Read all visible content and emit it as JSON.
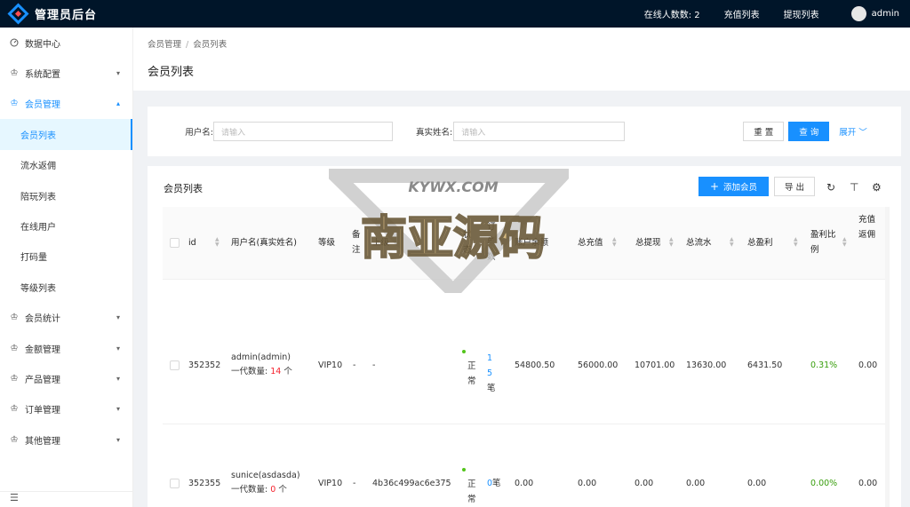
{
  "app": {
    "title": "管理员后台"
  },
  "topbar": {
    "online_label": "在线人数",
    "online_count": "2",
    "links": [
      "充值列表",
      "提现列表"
    ],
    "user": "admin"
  },
  "sidebar": {
    "items": [
      {
        "label": "数据中心",
        "icon": "dashboard-icon"
      },
      {
        "label": "系统配置",
        "icon": "crown-icon"
      },
      {
        "label": "会员管理",
        "icon": "crown-icon"
      },
      {
        "label": "会员列表"
      },
      {
        "label": "流水返佣"
      },
      {
        "label": "陪玩列表"
      },
      {
        "label": "在线用户"
      },
      {
        "label": "打码量"
      },
      {
        "label": "等级列表"
      },
      {
        "label": "会员统计",
        "icon": "crown-icon"
      },
      {
        "label": "金额管理",
        "icon": "crown-icon"
      },
      {
        "label": "产品管理",
        "icon": "crown-icon"
      },
      {
        "label": "订单管理",
        "icon": "crown-icon"
      },
      {
        "label": "其他管理",
        "icon": "crown-icon"
      }
    ]
  },
  "breadcrumb": {
    "parent": "会员管理",
    "current": "会员列表"
  },
  "page_title": "会员列表",
  "search": {
    "username_label": "用户名:",
    "username_placeholder": "请输入",
    "realname_label": "真实姓名:",
    "realname_placeholder": "请输入",
    "reset": "重 置",
    "query": "查 询",
    "expand": "展开"
  },
  "table": {
    "title": "会员列表",
    "add_button": "添加会员",
    "export_button": "导 出",
    "columns": {
      "id": "id",
      "username": "用户名(真实姓名)",
      "level": "等级",
      "remark": "备注",
      "parent": "上级",
      "status": "状态",
      "orders": "订单数",
      "balance": "账户余额",
      "total_recharge": "总充值",
      "total_withdraw": "总提现",
      "total_flow": "总流水",
      "total_profit": "总盈利",
      "profit_ratio": "盈利比例",
      "recharge_rebate": "充值返佣"
    },
    "rows": [
      {
        "id": "352352",
        "username": "admin(admin)",
        "sub_label": "一代数量:",
        "sub_count": "14",
        "sub_unit": "个",
        "level": "VIP10",
        "remark": "-",
        "parent": "-",
        "status": "正常",
        "orders": "15",
        "orders_unit": "笔",
        "balance": "54800.50",
        "total_recharge": "56000.00",
        "total_withdraw": "10701.00",
        "total_flow": "13630.00",
        "total_profit": "6431.50",
        "profit_ratio": "0.31%",
        "recharge_rebate": "0.00"
      },
      {
        "id": "352355",
        "username": "sunice(asdasda)",
        "sub_label": "一代数量:",
        "sub_count": "0",
        "sub_unit": "个",
        "level": "VIP10",
        "remark": "-",
        "parent": "4b36c499ac6e375",
        "status": "正常",
        "orders": "0",
        "orders_unit": "笔",
        "balance": "0.00",
        "total_recharge": "0.00",
        "total_withdraw": "0.00",
        "total_flow": "0.00",
        "total_profit": "0.00",
        "profit_ratio": "0.00%",
        "recharge_rebate": "0.00"
      }
    ]
  },
  "watermark": {
    "top_text": "KYWX.COM",
    "main_text": "南亚源码"
  },
  "colors": {
    "primary": "#1890ff",
    "header_bg": "#001529",
    "danger": "#f5222d",
    "success": "#52c41a"
  }
}
